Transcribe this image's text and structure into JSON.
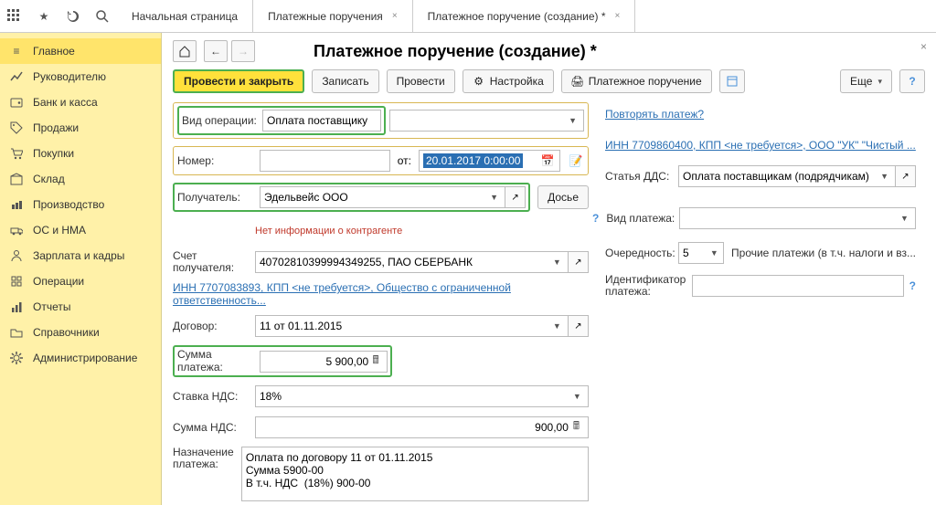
{
  "topTabs": {
    "home": "Начальная страница",
    "list": "Платежные поручения",
    "doc": "Платежное поручение (создание) *"
  },
  "sidebar": [
    "Главное",
    "Руководителю",
    "Банк и касса",
    "Продажи",
    "Покупки",
    "Склад",
    "Производство",
    "ОС и НМА",
    "Зарплата и кадры",
    "Операции",
    "Отчеты",
    "Справочники",
    "Администрирование"
  ],
  "pageTitle": "Платежное поручение (создание) *",
  "toolbar": {
    "post_close": "Провести и закрыть",
    "write": "Записать",
    "post": "Провести",
    "settings": "Настройка",
    "pform": "Платежное поручение",
    "more": "Еще"
  },
  "labels": {
    "op_type": "Вид операции:",
    "number": "Номер:",
    "from": "от:",
    "recipient": "Получатель:",
    "dossier": "Досье",
    "noinfo": "Нет информации о контрагенте",
    "account": "Счет получателя:",
    "contract": "Договор:",
    "sum": "Сумма платежа:",
    "vat_rate": "Ставка НДС:",
    "vat_sum": "Сумма НДС:",
    "purpose": "Назначение платежа:",
    "repeat": "Повторять платеж?",
    "dds": "Статья ДДС:",
    "pay_type": "Вид платежа:",
    "priority": "Очередность:",
    "priority_text": "Прочие платежи (в т.ч. налоги и вз...",
    "pay_id": "Идентификатор платежа:",
    "inn_link": "ИНН 7709860400, КПП <не требуется>, ООО \"УК\" \"Чистый ...",
    "recipient_bank_link": "ИНН 7707083893, КПП <не требуется>, Общество с ограниченной ответственность..."
  },
  "values": {
    "op_type": "Оплата поставщику",
    "date": "20.01.2017  0:00:00",
    "recipient": "Эдельвейс ООО",
    "account": "40702810399994349255, ПАО СБЕРБАНК",
    "contract": "11 от 01.11.2015",
    "sum": "5 900,00",
    "vat_rate": "18%",
    "vat_sum": "900,00",
    "purpose": "Оплата по договору 11 от 01.11.2015\nСумма 5900-00\nВ т.ч. НДС  (18%) 900-00",
    "dds": "Оплата поставщикам (подрядчикам)",
    "priority": "5"
  }
}
